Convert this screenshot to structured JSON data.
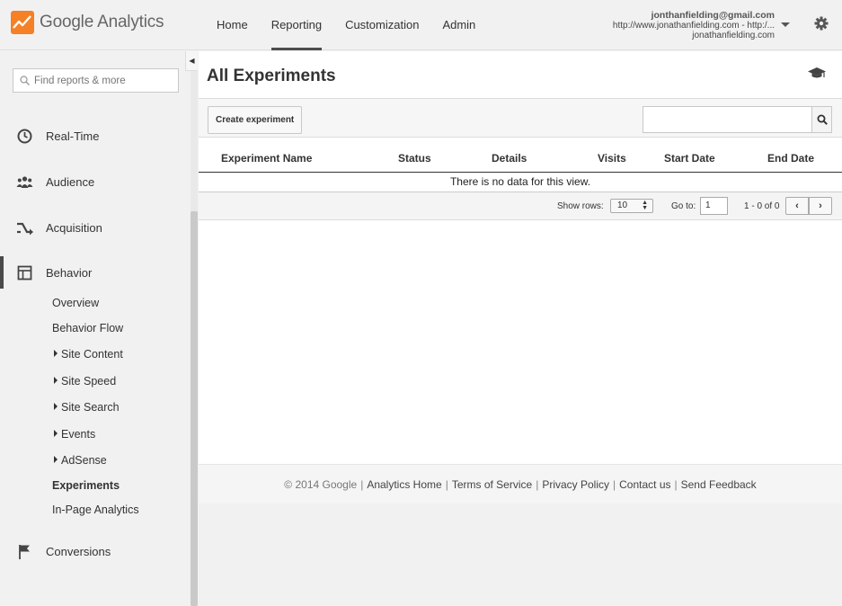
{
  "app": {
    "name": "Google Analytics"
  },
  "nav": {
    "items": [
      "Home",
      "Reporting",
      "Customization",
      "Admin"
    ],
    "active": "Reporting"
  },
  "account": {
    "email": "jonthanfielding@gmail.com",
    "property": "http://www.jonathanfielding.com - http:/...",
    "view": "jonathanfielding.com"
  },
  "sidebar": {
    "search_placeholder": "Find reports & more",
    "sections": {
      "realtime": "Real-Time",
      "audience": "Audience",
      "acquisition": "Acquisition",
      "behavior": "Behavior",
      "conversions": "Conversions"
    },
    "behavior_items": {
      "overview": "Overview",
      "flow": "Behavior Flow",
      "site_content": "Site Content",
      "site_speed": "Site Speed",
      "site_search": "Site Search",
      "events": "Events",
      "adsense": "AdSense",
      "experiments": "Experiments",
      "inpage": "In-Page Analytics"
    }
  },
  "page": {
    "title": "All Experiments",
    "create_button": "Create experiment",
    "columns": {
      "name": "Experiment Name",
      "status": "Status",
      "details": "Details",
      "visits": "Visits",
      "start": "Start Date",
      "end": "End Date"
    },
    "empty_message": "There is no data for this view.",
    "pager": {
      "show_rows_label": "Show rows:",
      "rows_value": "10",
      "goto_label": "Go to:",
      "goto_value": "1",
      "range": "1 - 0 of 0"
    }
  },
  "footer": {
    "copyright": "© 2014 Google",
    "links": {
      "home": "Analytics Home",
      "terms": "Terms of Service",
      "privacy": "Privacy Policy",
      "contact": "Contact us",
      "feedback": "Send Feedback"
    }
  },
  "colors": {
    "brand_orange": "#f58025",
    "active_indicator": "#4d4d4d"
  }
}
